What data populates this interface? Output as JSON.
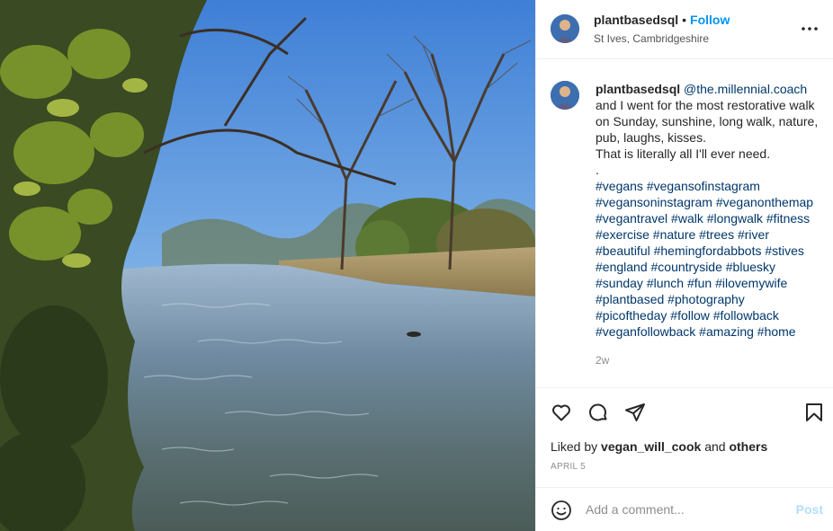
{
  "post": {
    "author": "plantbasedsql",
    "follow_label": "Follow",
    "separator": "•",
    "location": "St Ives, Cambridgeshire",
    "more_icon": "more-horizontal-icon",
    "photo_description": "river-scene-photo"
  },
  "caption": {
    "author": "plantbasedsql",
    "mention": "@the.millennial.coach",
    "lines": [
      "and I went for the most restorative walk",
      "on Sunday, sunshine, long walk, nature,",
      "pub, laughs, kisses.",
      "That is literally all I'll ever need.",
      "."
    ],
    "hashtag_lines": [
      "#vegans #vegansofinstagram",
      "#vegansoninstagram #veganonthemap",
      "#vegantravel #walk #longwalk #fitness",
      "#exercise #nature #trees #river",
      "#beautiful #hemingfordabbots #stives",
      "#england #countryside #bluesky",
      "#sunday #lunch #fun #ilovemywife",
      "#plantbased #photography",
      "#picoftheday #follow #followback",
      "#veganfollowback #amazing #home"
    ],
    "time_ago": "2w"
  },
  "actions": {
    "like_icon": "heart-icon",
    "comment_icon": "comment-icon",
    "share_icon": "send-icon",
    "save_icon": "bookmark-icon"
  },
  "likes": {
    "prefix": "Liked by",
    "user": "vegan_will_cook",
    "connector": "and",
    "others": "others"
  },
  "date": "APRIL 5",
  "comment": {
    "placeholder": "Add a comment...",
    "post_label": "Post",
    "emoji_icon": "emoji-icon"
  },
  "colors": {
    "follow": "#0095f6",
    "hashtag": "#00376b",
    "muted": "#8e8e8e",
    "post_disabled": "#b2dffc",
    "border": "#efefef"
  }
}
